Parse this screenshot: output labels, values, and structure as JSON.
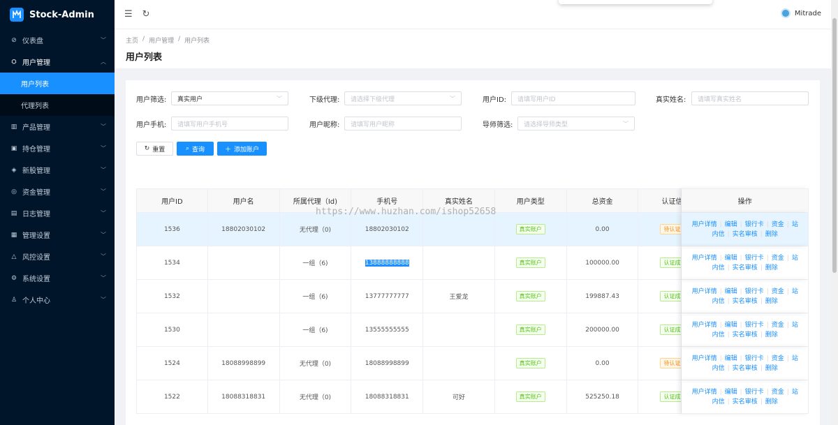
{
  "app": {
    "title": "Stock-Admin"
  },
  "sidebar": {
    "items": [
      {
        "label": "仪表盘",
        "icon": "dashboard-icon",
        "glyph": "⊘"
      },
      {
        "label": "用户管理",
        "icon": "users-icon",
        "glyph": "⛭",
        "open": true,
        "children": [
          {
            "label": "用户列表",
            "active": true
          },
          {
            "label": "代理列表"
          }
        ]
      },
      {
        "label": "产品管理",
        "icon": "chart-icon",
        "glyph": "▥"
      },
      {
        "label": "持仓管理",
        "icon": "position-icon",
        "glyph": "▣"
      },
      {
        "label": "新股管理",
        "icon": "ipo-icon",
        "glyph": "◈"
      },
      {
        "label": "资金管理",
        "icon": "money-icon",
        "glyph": "◎"
      },
      {
        "label": "日志管理",
        "icon": "log-icon",
        "glyph": "▤"
      },
      {
        "label": "管理设置",
        "icon": "settings-panel-icon",
        "glyph": "▦"
      },
      {
        "label": "风控设置",
        "icon": "warning-icon",
        "glyph": "△"
      },
      {
        "label": "系统设置",
        "icon": "gear-icon",
        "glyph": "⚙"
      },
      {
        "label": "个人中心",
        "icon": "person-icon",
        "glyph": "♙"
      }
    ]
  },
  "header": {
    "username": "Mitrade"
  },
  "breadcrumb": [
    "主页",
    "用户管理",
    "用户列表"
  ],
  "page_title": "用户列表",
  "filters": {
    "user_filter": {
      "label": "用户筛选:",
      "value": "真实用户"
    },
    "sub_agent": {
      "label": "下级代理:",
      "placeholder": "请选择下级代理"
    },
    "user_id": {
      "label": "用户ID:",
      "placeholder": "请填写用户ID"
    },
    "real_name": {
      "label": "真实姓名:",
      "placeholder": "请填写真实姓名"
    },
    "user_phone": {
      "label": "用户手机:",
      "placeholder": "请填写用户手机号"
    },
    "nickname": {
      "label": "用户昵称:",
      "placeholder": "请填写用户昵称"
    },
    "mentor": {
      "label": "导师筛选:",
      "placeholder": "请选择导师类型"
    }
  },
  "buttons": {
    "reset": "重置",
    "query": "查询",
    "add": "添加账户"
  },
  "table": {
    "columns": [
      "用户ID",
      "用户名",
      "所属代理（Id)",
      "手机号",
      "真实姓名",
      "用户类型",
      "总资金",
      "认证信息",
      "操作"
    ],
    "rows": [
      {
        "id": "1536",
        "username": "18802030102",
        "agent": "无代理（0)",
        "phone": "18802030102",
        "real_name": "",
        "type": "真实账户",
        "funds": "0.00",
        "auth": "待认证",
        "auth_color": "orange",
        "highlight": true
      },
      {
        "id": "1534",
        "username": "",
        "agent": "一组（6)",
        "phone": "13888888888",
        "real_name": "",
        "type": "真实账户",
        "funds": "100000.00",
        "auth": "认证成功",
        "auth_color": "green",
        "phone_selected": true
      },
      {
        "id": "1532",
        "username": "",
        "agent": "一组（6)",
        "phone": "13777777777",
        "real_name": "王爱龙",
        "type": "真实账户",
        "funds": "199887.43",
        "auth": "认证成功",
        "auth_color": "green"
      },
      {
        "id": "1530",
        "username": "",
        "agent": "一组（6)",
        "phone": "13555555555",
        "real_name": "",
        "type": "真实账户",
        "funds": "200000.00",
        "auth": "认证成功",
        "auth_color": "green"
      },
      {
        "id": "1524",
        "username": "18088998899",
        "agent": "无代理（0)",
        "phone": "18088998899",
        "real_name": "",
        "type": "真实账户",
        "funds": "0.00",
        "auth": "待认证",
        "auth_color": "orange"
      },
      {
        "id": "1522",
        "username": "18088318831",
        "agent": "无代理（0)",
        "phone": "18088318831",
        "real_name": "可好",
        "type": "真实账户",
        "funds": "525250.18",
        "auth": "认证成功",
        "auth_color": "green"
      }
    ],
    "actions_line1": [
      "用户详情",
      "编辑",
      "银行卡",
      "资金",
      "站"
    ],
    "actions_line2": [
      "内信",
      "实名审核",
      "删除"
    ]
  },
  "watermark": "https://www.huzhan.com/ishop52658",
  "colors": {
    "primary": "#1890ff",
    "sidebar_bg": "#001529",
    "success": "#52c41a",
    "warning": "#fa8c16"
  }
}
